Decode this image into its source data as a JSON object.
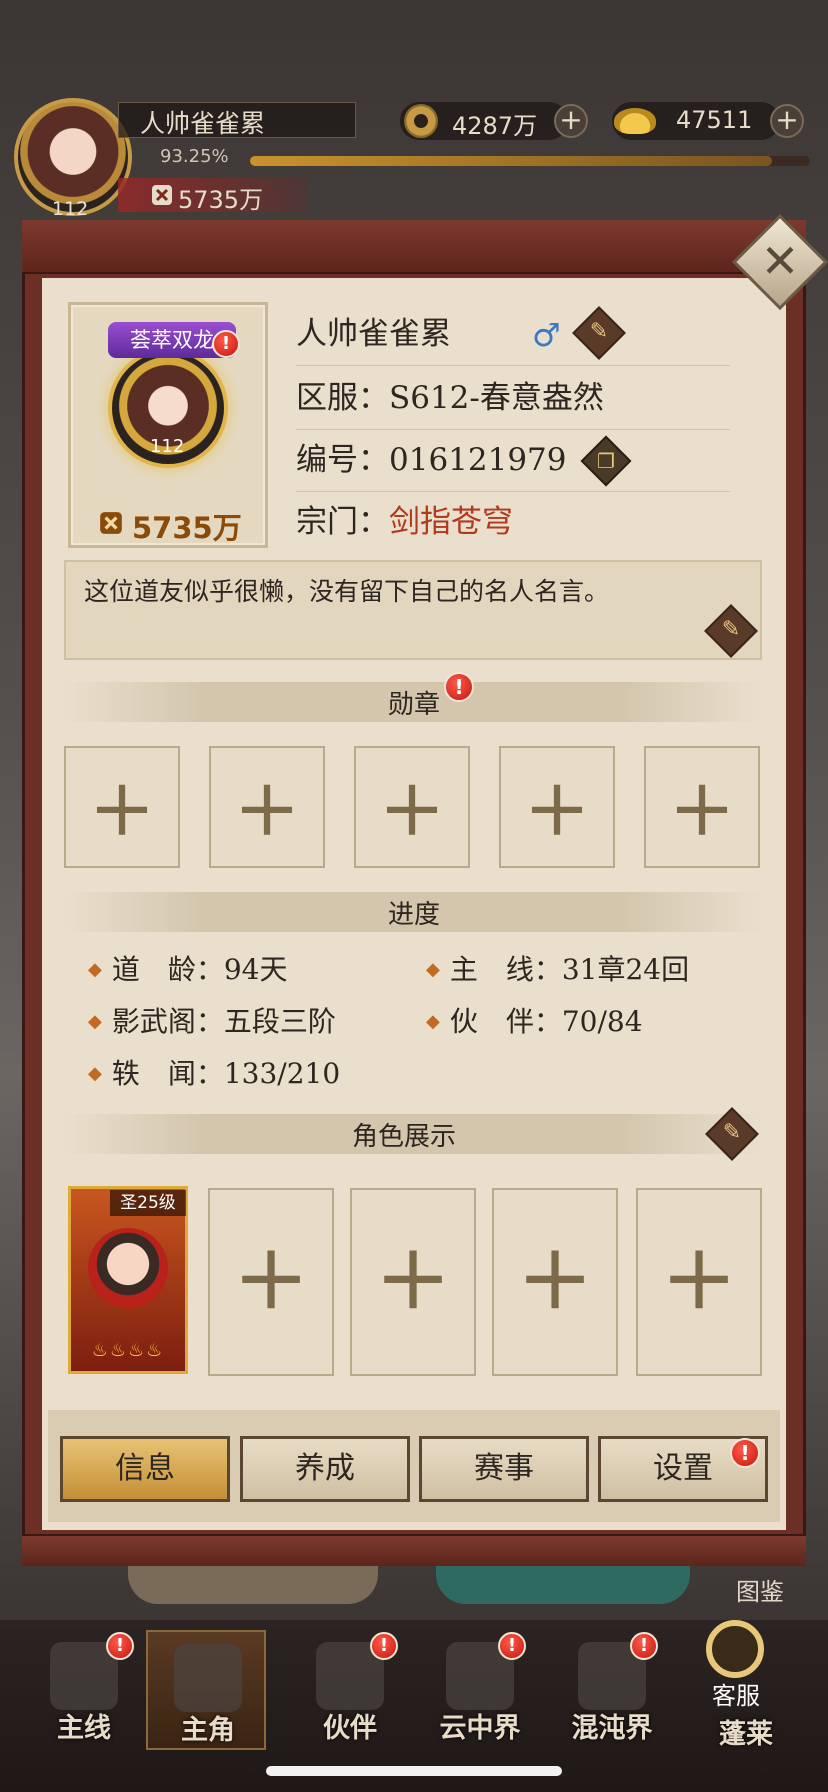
{
  "topbar": {
    "player_name": "人帅雀雀累",
    "exp_percent": "93.25%",
    "exp_fraction": 0.9325,
    "level": "112",
    "power": "5735万",
    "coins": "4287万",
    "ingots": "47511",
    "plus_label": "+"
  },
  "profile": {
    "title_badge": "荟萃双龙",
    "name": "人帅雀雀累",
    "gender_symbol": "♂",
    "server_label": "区服：",
    "server_value": "S612-春意盎然",
    "id_label": "编号：",
    "id_value": "016121979",
    "guild_label": "宗门：",
    "guild_value": "剑指苍穹",
    "level": "112",
    "power": "5735万",
    "motto": "这位道友似乎很懒，没有留下自己的名人名言。"
  },
  "medals": {
    "title": "勋章",
    "slots": [
      "+",
      "+",
      "+",
      "+",
      "+"
    ]
  },
  "progress": {
    "title": "进度",
    "items": [
      {
        "label": "道　龄：",
        "value": "94天"
      },
      {
        "label": "主　线：",
        "value": "31章24回"
      },
      {
        "label": "影武阁：",
        "value": "五段三阶"
      },
      {
        "label": "伙　伴：",
        "value": "70/84"
      },
      {
        "label": "轶　闻：",
        "value": "133/210"
      }
    ]
  },
  "showcase": {
    "title": "角色展示",
    "hero_level": "圣25级",
    "hero_flames": "♨♨♨♨",
    "empty_slots": [
      "+",
      "+",
      "+",
      "+"
    ]
  },
  "tabs": [
    "信息",
    "养成",
    "赛事",
    "设置"
  ],
  "alert_mark": "!",
  "background": {
    "tujian": "图鉴"
  },
  "bottom_nav": [
    {
      "label": "主线"
    },
    {
      "label": "主角"
    },
    {
      "label": "伙伴"
    },
    {
      "label": "云中界"
    },
    {
      "label": "混沌界"
    },
    {
      "label": "蓬莱"
    }
  ],
  "service": {
    "label": "客服"
  },
  "colors": {
    "panel_frame": "#6b2f25",
    "panel_paper": "#e9dfcc",
    "guild_red": "#b03a1e",
    "active_tab": "#c48f36",
    "alert_red": "#c4160f"
  },
  "icons": {
    "edit": "brush-icon",
    "copy": "copy-icon",
    "close": "close-icon",
    "coin": "coin-icon",
    "ingot": "ingot-icon",
    "gender": "male-icon",
    "power": "power-icon"
  }
}
